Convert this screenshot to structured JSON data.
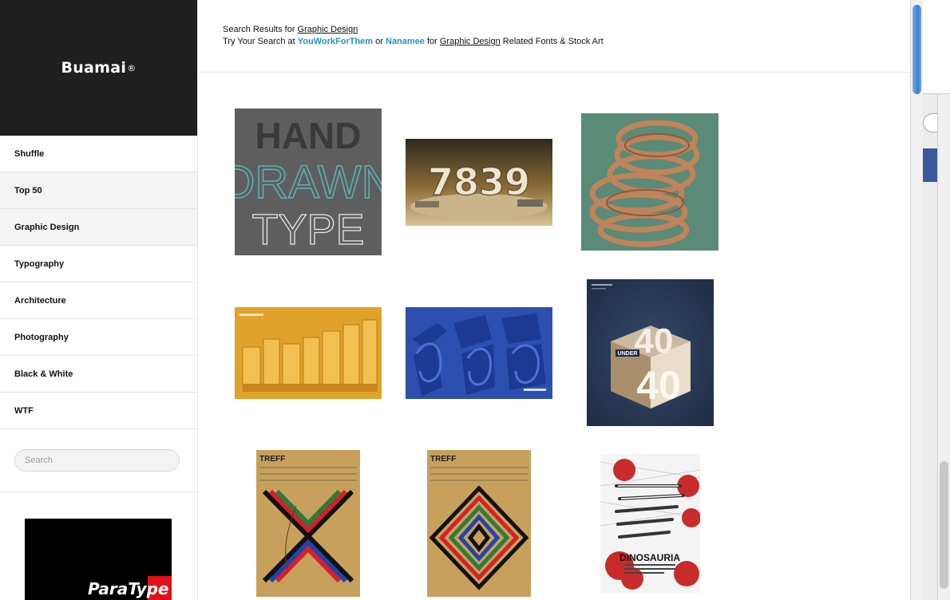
{
  "brand": {
    "name": "Buamai",
    "mark": "®"
  },
  "nav": [
    {
      "label": "Shuffle"
    },
    {
      "label": "Top 50"
    },
    {
      "label": "Graphic Design"
    },
    {
      "label": "Typography"
    },
    {
      "label": "Architecture"
    },
    {
      "label": "Photography"
    },
    {
      "label": "Black & White"
    },
    {
      "label": "WTF"
    }
  ],
  "search": {
    "placeholder": "Search"
  },
  "ad": {
    "text": "ParaType"
  },
  "header": {
    "line1_prefix": "Search Results for ",
    "query": "Graphic Design",
    "line2_prefix": "Try Your Search at ",
    "site1": "YouWorkForThem",
    "or": " or ",
    "site2": "Nanamee",
    "for": " for ",
    "query2": "Graphic Design",
    "suffix": " Related Fonts & Stock Art"
  },
  "thumbs": {
    "t1": {
      "l1": "HAND",
      "l2": "DRAWN",
      "l3": "TYPE"
    },
    "t2": {
      "text": "7839"
    },
    "t6": {
      "label": "UNDER",
      "num_top": "40",
      "num_bottom": "40"
    },
    "t7": {
      "title": "TREFF"
    },
    "t8": {
      "title": "TREFF"
    },
    "t9": {
      "title": "DINOSAURIA"
    }
  },
  "colors": {
    "accent": "#1e94c7",
    "sidebar_dark": "#1f1f1f"
  }
}
